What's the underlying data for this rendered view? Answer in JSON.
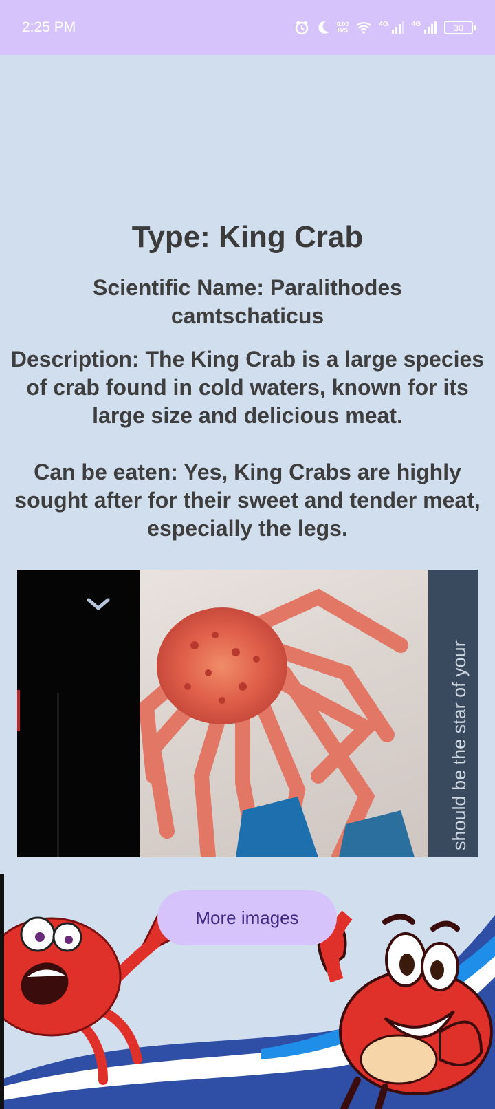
{
  "status_bar": {
    "time": "2:25 PM",
    "net_speed_top": "0.00",
    "net_speed_bottom": "B/S",
    "signal1_label": "4G",
    "signal2_label": "4G",
    "battery": "30",
    "icons": [
      "alarm-icon",
      "moon-icon",
      "wifi-icon",
      "signal-icon",
      "signal-icon",
      "battery-icon"
    ]
  },
  "crab": {
    "type_line": "Type: King Crab",
    "scientific_line": "Scientific Name: Paralithodes camtschaticus",
    "description_line": "Description: The King Crab is a large species of crab found in cold waters, known for its large size and delicious meat.",
    "edible_line": "Can be eaten: Yes, King Crabs are highly sought after for their sweet and tender meat, especially the legs."
  },
  "photo": {
    "caption": "should be the star of your"
  },
  "buttons": {
    "more_images": "More images"
  },
  "colors": {
    "background": "#d1deed",
    "status_bar": "#d6c3fb",
    "button": "#d6c3fb",
    "button_text": "#3c2a86",
    "crab_red": "#e0302a",
    "wave_blue": "#2a4aa0"
  }
}
